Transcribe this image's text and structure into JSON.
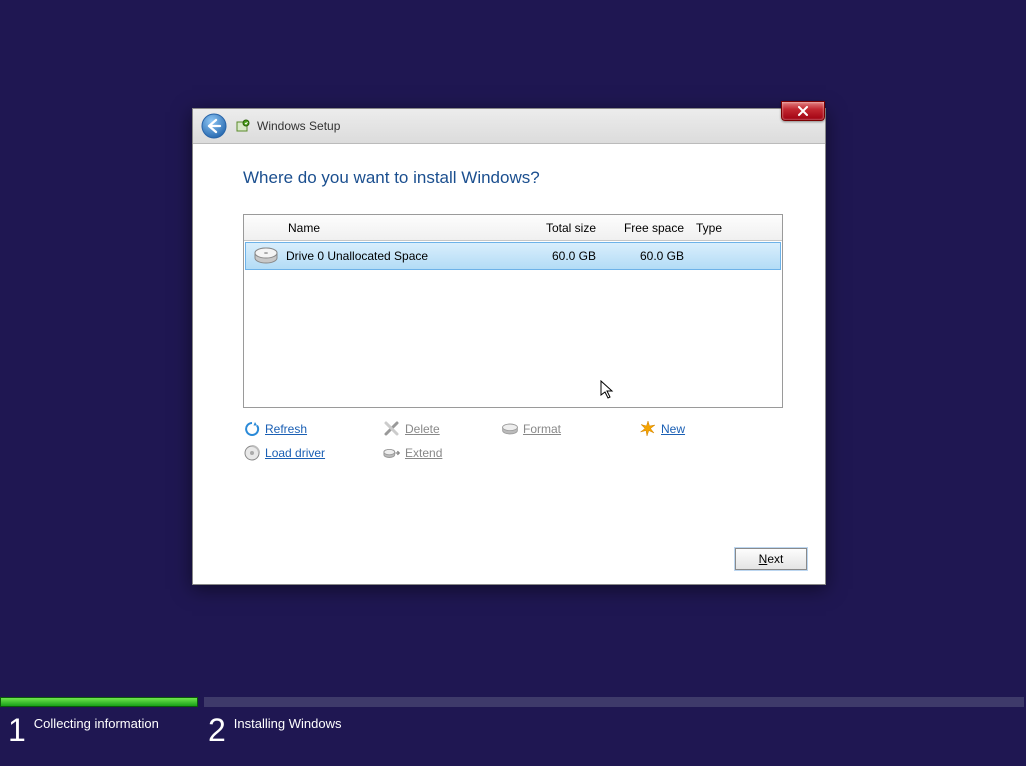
{
  "window": {
    "title": "Windows Setup"
  },
  "heading": "Where do you want to install Windows?",
  "table": {
    "headers": {
      "name": "Name",
      "total": "Total size",
      "free": "Free space",
      "type": "Type"
    },
    "rows": [
      {
        "name": "Drive 0 Unallocated Space",
        "total": "60.0 GB",
        "free": "60.0 GB",
        "type": ""
      }
    ]
  },
  "actions": {
    "refresh": "Refresh",
    "delete": "Delete",
    "format": "Format",
    "new": "New",
    "load_driver": "Load driver",
    "extend": "Extend"
  },
  "next": "Next",
  "steps": {
    "s1num": "1",
    "s1label": "Collecting information",
    "s2num": "2",
    "s2label": "Installing Windows"
  }
}
